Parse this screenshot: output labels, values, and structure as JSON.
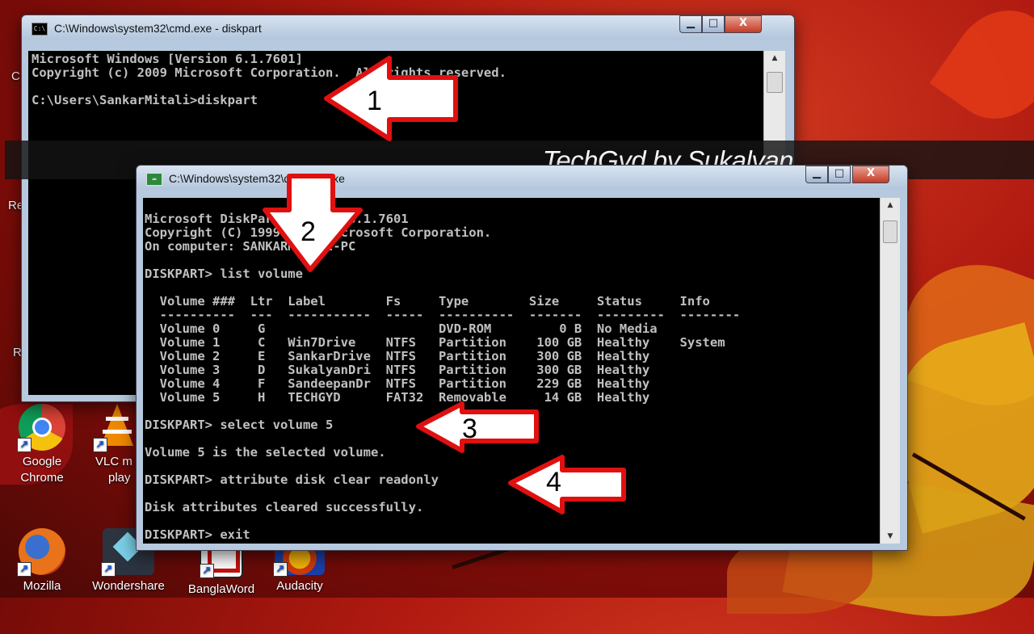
{
  "wallpaper": {
    "accent": "#c0281a"
  },
  "desktop": {
    "edge_letters": [
      "C",
      "Re",
      "R"
    ],
    "icons": [
      {
        "icon": "chrome-icon",
        "label_lines": [
          "Google",
          "Chrome"
        ]
      },
      {
        "icon": "vlc-icon",
        "label_lines": [
          "VLC m",
          "play"
        ]
      },
      {
        "icon": "firefox-icon",
        "label_lines": [
          "Mozilla"
        ]
      },
      {
        "icon": "wondershare-icon",
        "label_lines": [
          "Wondershare"
        ]
      },
      {
        "icon": "banglaword-icon",
        "label_lines": [
          "BanglaWord"
        ]
      },
      {
        "icon": "audacity-icon",
        "label_lines": [
          "Audacity"
        ]
      }
    ]
  },
  "cmd_window": {
    "title": "C:\\Windows\\system32\\cmd.exe - diskpart",
    "lines": [
      "Microsoft Windows [Version 6.1.7601]",
      "Copyright (c) 2009 Microsoft Corporation.  All rights reserved.",
      "",
      "C:\\Users\\SankarMitali>diskpart"
    ]
  },
  "diskpart_window": {
    "title": "C:\\Windows\\system32\\diskpart.exe",
    "lines": [
      "Microsoft DiskPart version 6.1.7601",
      "Copyright (C) 1999-2008 Microsoft Corporation.",
      "On computer: SANKARMITALI-PC",
      "",
      "DISKPART> list volume",
      "",
      "  Volume ###  Ltr  Label        Fs     Type        Size     Status     Info",
      "  ----------  ---  -----------  -----  ----------  -------  ---------  --------",
      "  Volume 0     G                       DVD-ROM         0 B  No Media",
      "  Volume 1     C   Win7Drive    NTFS   Partition    100 GB  Healthy    System",
      "  Volume 2     E   SankarDrive  NTFS   Partition    300 GB  Healthy",
      "  Volume 3     D   SukalyanDri  NTFS   Partition    300 GB  Healthy",
      "  Volume 4     F   SandeepanDr  NTFS   Partition    229 GB  Healthy",
      "  Volume 5     H   TECHGYD      FAT32  Removable     14 GB  Healthy",
      "",
      "DISKPART> select volume 5",
      "",
      "Volume 5 is the selected volume.",
      "",
      "DISKPART> attribute disk clear readonly",
      "",
      "Disk attributes cleared successfully.",
      "",
      "DISKPART> exit"
    ]
  },
  "window_controls": {
    "minimize": "▁",
    "maximize": "□",
    "close": "X"
  },
  "watermark": "TechGyd by Sukalyan",
  "annotations": [
    {
      "number": "1"
    },
    {
      "number": "2"
    },
    {
      "number": "3"
    },
    {
      "number": "4"
    }
  ],
  "arrow_colors": {
    "fill": "#ffffff",
    "stroke": "#e01010"
  }
}
